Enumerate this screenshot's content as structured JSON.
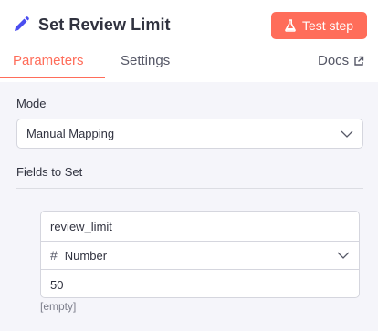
{
  "header": {
    "title": "Set Review Limit",
    "test_button_label": "Test step"
  },
  "tabs": {
    "parameters": "Parameters",
    "settings": "Settings",
    "docs": "Docs"
  },
  "mode": {
    "label": "Mode",
    "value": "Manual Mapping"
  },
  "fields": {
    "label": "Fields to Set",
    "name": "review_limit",
    "type": "Number",
    "value": "50",
    "hint": "[empty]"
  },
  "colors": {
    "accent": "#ff6d5a",
    "title_icon": "#4a4df0"
  },
  "icons": {
    "title": "pencil-icon",
    "test": "flask-icon",
    "docs": "external-link-icon",
    "select": "chevron-down-icon",
    "type": "hash-icon"
  }
}
